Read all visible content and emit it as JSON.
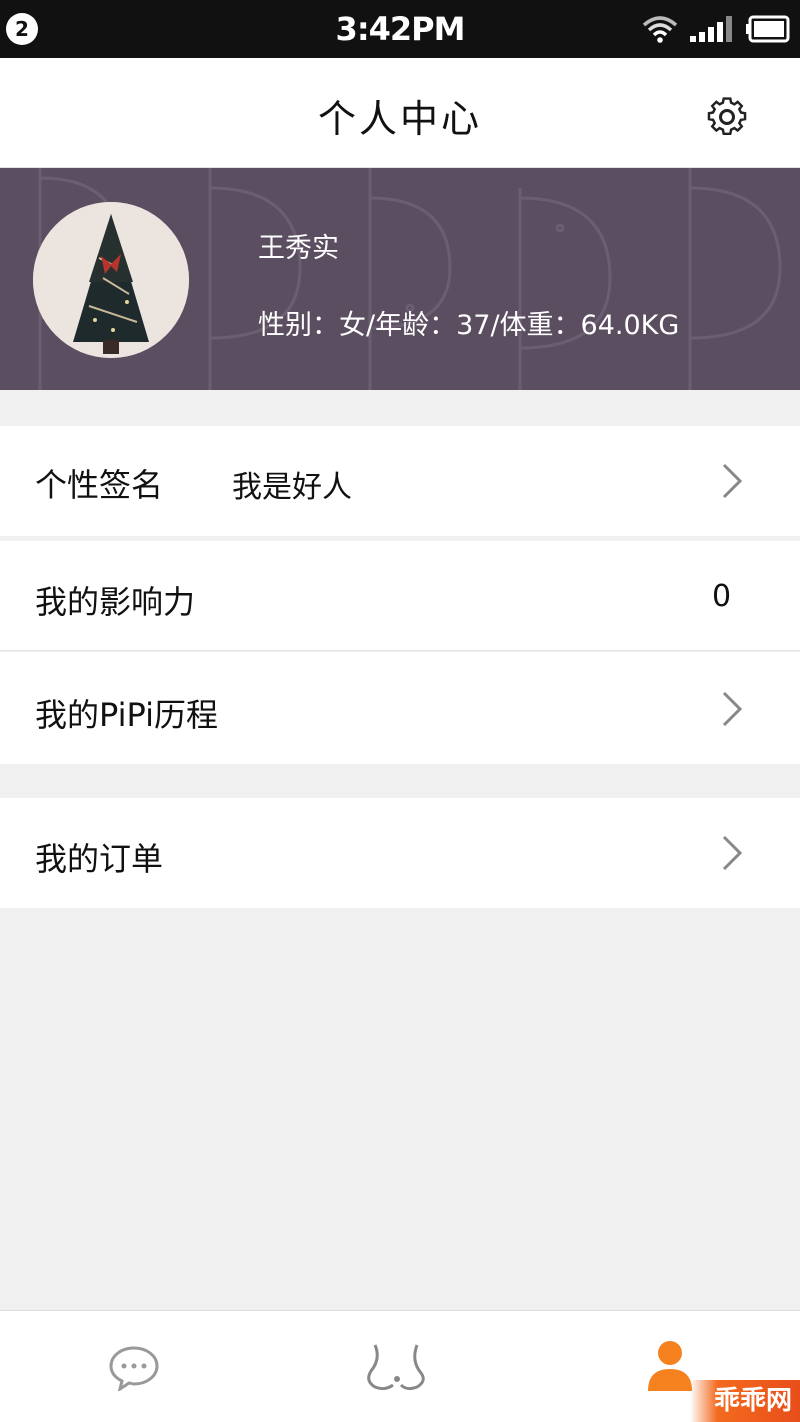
{
  "status_bar": {
    "notification_count": "2",
    "time": "3:42PM",
    "icons": [
      "wifi-icon",
      "signal-icon",
      "battery-icon"
    ]
  },
  "header": {
    "title": "个人中心",
    "settings_icon": "gear-icon"
  },
  "profile": {
    "name": "王秀实",
    "stats": "性别：女/年龄：37/体重：64.0KG",
    "avatar": "christmas-tree-photo",
    "banner_color": "#5a4e60"
  },
  "menu": {
    "signature": {
      "label": "个性签名",
      "value": "我是好人"
    },
    "influence": {
      "label": "我的影响力",
      "value": "0"
    },
    "history": {
      "label": "我的PiPi历程"
    },
    "orders": {
      "label": "我的订单"
    }
  },
  "tab_bar": {
    "tabs": [
      {
        "icon": "chat-bubble-icon",
        "active": false
      },
      {
        "icon": "discover-icon",
        "active": false
      },
      {
        "icon": "person-icon",
        "active": true
      }
    ],
    "active_color": "#f5821f"
  },
  "watermark": "乖乖网"
}
